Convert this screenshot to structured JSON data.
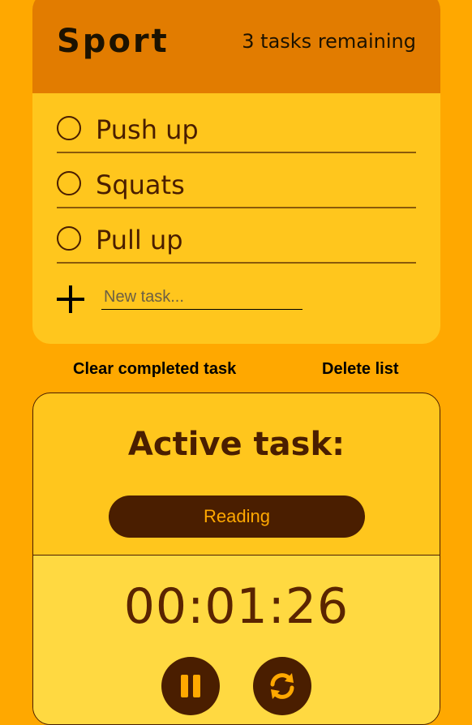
{
  "list": {
    "title": "Sport",
    "remaining": "3 tasks remaining",
    "tasks": [
      {
        "label": "Push up"
      },
      {
        "label": "Squats"
      },
      {
        "label": "Pull up"
      }
    ],
    "new_task_placeholder": "New task...",
    "new_task_value": ""
  },
  "actions": {
    "clear_completed": "Clear completed task",
    "delete_list": "Delete list"
  },
  "active": {
    "title": "Active task:",
    "task_name": "Reading",
    "timer": "00:01:26"
  },
  "icons": {
    "add": "plus-icon",
    "pause": "pause-icon",
    "reset": "refresh-icon"
  },
  "colors": {
    "background": "#ffa800",
    "header": "#e27c00",
    "card": "#ffc61d",
    "timer_panel": "#ffd941",
    "dark_brown": "#4a1e00"
  }
}
